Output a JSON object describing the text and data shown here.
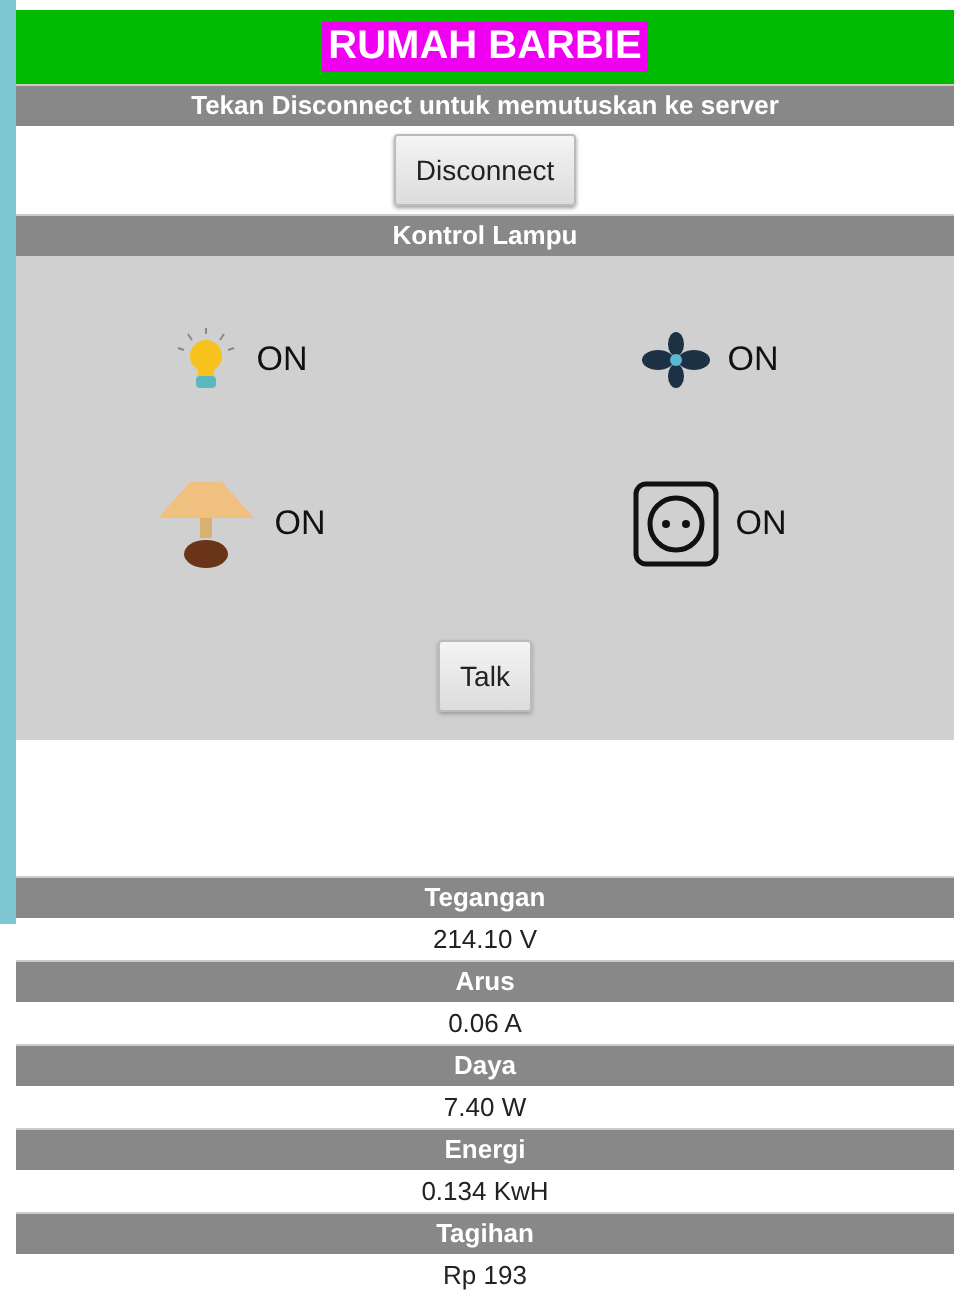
{
  "app_title": "RUMAH BARBIE",
  "connection": {
    "hint": "Tekan Disconnect untuk memutuskan ke server",
    "button": "Disconnect"
  },
  "control": {
    "title": "Kontrol Lampu",
    "devices": [
      {
        "kind": "bulb",
        "state": "ON"
      },
      {
        "kind": "fan",
        "state": "ON"
      },
      {
        "kind": "lamp",
        "state": "ON"
      },
      {
        "kind": "socket",
        "state": "ON"
      }
    ],
    "button": "Talk"
  },
  "readings": [
    {
      "label": "Tegangan",
      "value": "214.10 V"
    },
    {
      "label": "Arus",
      "value": "0.06 A"
    },
    {
      "label": "Daya",
      "value": "7.40 W"
    },
    {
      "label": "Energi",
      "value": "0.134 KwH"
    },
    {
      "label": "Tagihan",
      "value": "Rp 193"
    }
  ]
}
